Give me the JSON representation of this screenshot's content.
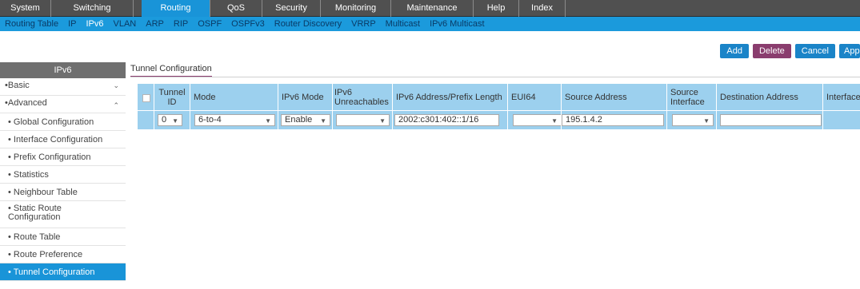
{
  "topnav": {
    "tabs": [
      {
        "label": "System"
      },
      {
        "label": "Switching"
      },
      {
        "label": "Routing"
      },
      {
        "label": "QoS"
      },
      {
        "label": "Security"
      },
      {
        "label": "Monitoring"
      },
      {
        "label": "Maintenance"
      },
      {
        "label": "Help"
      },
      {
        "label": "Index"
      }
    ],
    "active": "Routing"
  },
  "subnav": {
    "items": [
      "Routing Table",
      "IP",
      "IPv6",
      "VLAN",
      "ARP",
      "RIP",
      "OSPF",
      "OSPFv3",
      "Router Discovery",
      "VRRP",
      "Multicast",
      "IPv6 Multicast"
    ],
    "active": "IPv6"
  },
  "sidebar": {
    "title": "IPv6",
    "items": [
      {
        "label": "Basic"
      },
      {
        "label": "Advanced"
      },
      {
        "label": "Global Configuration"
      },
      {
        "label": "Interface Configuration"
      },
      {
        "label": "Prefix Configuration"
      },
      {
        "label": "Statistics"
      },
      {
        "label": "Neighbour Table"
      },
      {
        "label": "Static Route Configuration"
      },
      {
        "label": "Route Table"
      },
      {
        "label": "Route Preference"
      },
      {
        "label": "Tunnel Configuration"
      }
    ],
    "active": "Tunnel Configuration"
  },
  "buttons": {
    "add": "Add",
    "delete": "Delete",
    "cancel": "Cancel",
    "apply": "Apply"
  },
  "section": {
    "title": "Tunnel Configuration"
  },
  "table": {
    "headers": {
      "tunnel_id": "Tunnel ID",
      "mode": "Mode",
      "ipv6_mode": "IPv6 Mode",
      "ipv6_unreachables": "IPv6 Unreachables",
      "prefix": "IPv6 Address/Prefix Length",
      "eui64": "EUI64",
      "source_address": "Source Address",
      "source_interface": "Source Interface",
      "destination_address": "Destination Address",
      "interface": "Interface"
    },
    "row": {
      "tunnel_id": "0",
      "mode": "6-to-4",
      "ipv6_mode": "Enable",
      "ipv6_unreachables": "",
      "prefix": "2002:c301:402::1/16",
      "eui64": "",
      "source_address": "195.1.4.2",
      "source_interface": "",
      "destination_address": ""
    }
  },
  "colors": {
    "accent": "#1994d8",
    "table_row": "#9cd0ee",
    "nav_bg": "#505050",
    "delete_button": "#8a3d6e"
  }
}
